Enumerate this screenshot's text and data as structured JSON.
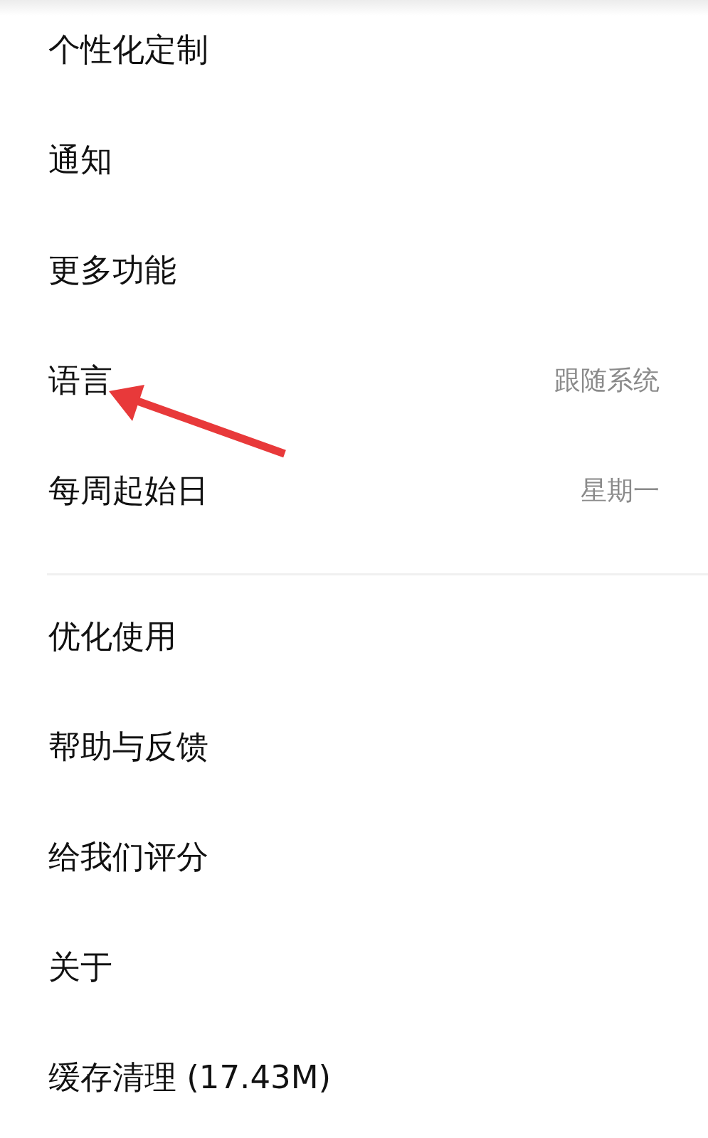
{
  "sections": [
    {
      "items": [
        {
          "label": "个性化定制"
        },
        {
          "label": "通知"
        },
        {
          "label": "更多功能"
        },
        {
          "label": "语言",
          "value": "跟随系统"
        },
        {
          "label": "每周起始日",
          "value": "星期一"
        }
      ]
    },
    {
      "items": [
        {
          "label": "优化使用"
        },
        {
          "label": "帮助与反馈"
        },
        {
          "label": "给我们评分"
        },
        {
          "label": "关于"
        },
        {
          "label": "缓存清理 (17.43M)"
        }
      ]
    }
  ],
  "annotation": {
    "kind": "arrow"
  }
}
